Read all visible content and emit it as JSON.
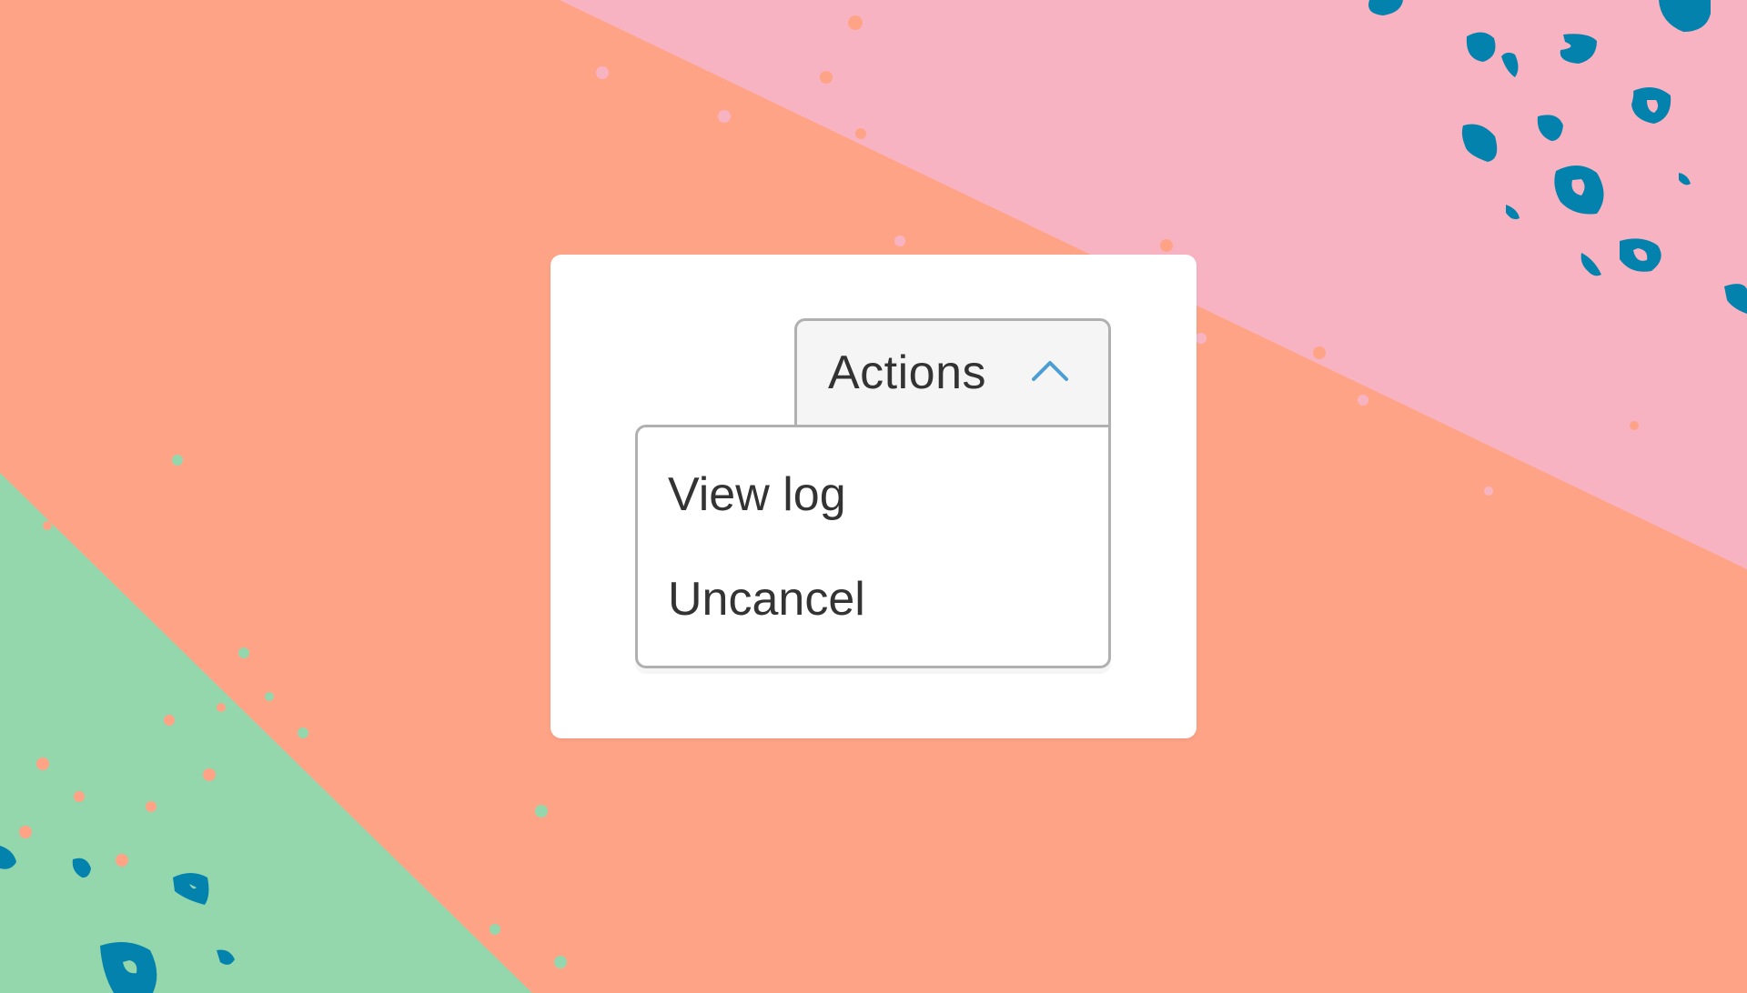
{
  "background": {
    "orange": "#ffa387",
    "pink": "#f8b3c3",
    "green": "#95d7ac",
    "blue": "#0482ae"
  },
  "actions_menu": {
    "button_label": "Actions",
    "button_icon": "chevron-up-icon",
    "items": [
      {
        "label": "View log"
      },
      {
        "label": "Uncancel"
      }
    ]
  },
  "colors": {
    "chevron": "#4a9ed4",
    "text": "#333333",
    "border": "#b0b0b0"
  }
}
